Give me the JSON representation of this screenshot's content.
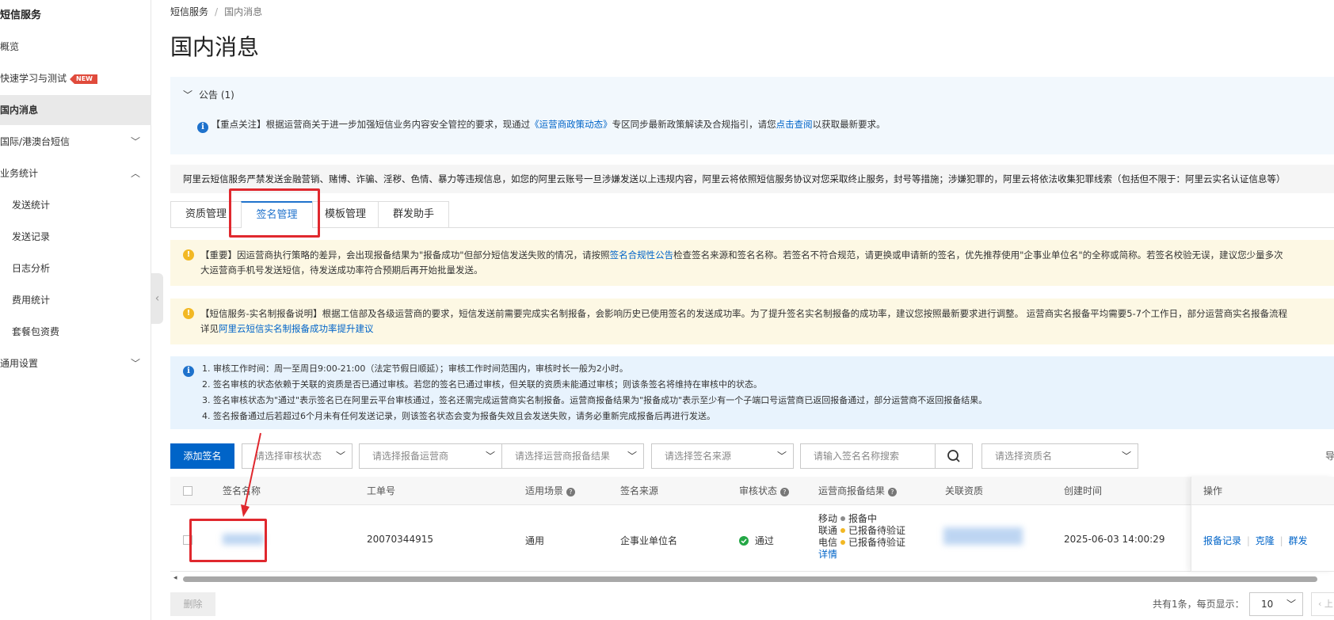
{
  "sidebar": {
    "title": "短信服务",
    "items": [
      {
        "label": "概览"
      },
      {
        "label": "快速学习与测试",
        "badge": "NEW"
      },
      {
        "label": "国内消息"
      },
      {
        "label": "国际/港澳台短信"
      },
      {
        "label": "业务统计"
      },
      {
        "label": "发送统计"
      },
      {
        "label": "发送记录"
      },
      {
        "label": "日志分析"
      },
      {
        "label": "费用统计"
      },
      {
        "label": "套餐包资费"
      },
      {
        "label": "通用设置"
      }
    ]
  },
  "breadcrumb": {
    "root": "短信服务",
    "current": "国内消息"
  },
  "page_title": "国内消息",
  "announcement": {
    "header": "公告 (1)",
    "p1": "【重点关注】根据运营商关于进一步加强短信业务内容安全管控的要求，现通过",
    "link1": "《运营商政策动态》",
    "p2": "专区同步最新政策解读及合规指引，请您",
    "link2": "点击查阅",
    "p3": "以获取最新要求。"
  },
  "warning_strip": "阿里云短信服务严禁发送金融营销、赌博、诈骗、淫秽、色情、暴力等违规信息，如您的阿里云账号一旦涉嫌发送以上违规内容，阿里云将依照短信服务协议对您采取终止服务，封号等措施；涉嫌犯罪的，阿里云将依法收集犯罪线索（包括但不限于：阿里云实名认证信息等）",
  "tabs": [
    "资质管理",
    "签名管理",
    "模板管理",
    "群发助手"
  ],
  "notice_important": {
    "a": "【重要】因运营商执行策略的差异，会出现报备结果为\"报备成功\"但部分短信发送失败的情况，请按照",
    "link": "签名合规性公告",
    "b": "检查签名来源和签名名称。若签名不符合规范，请更换或申请新的签名，优先推荐使用\"企事业单位名\"的全称或简称。若签名校验无误，建议您少量多次",
    "c": "大运营商手机号发送短信，待发送成功率符合预期后再开始批量发送。"
  },
  "notice_realname": {
    "a": "【短信服务-实名制报备说明】根据工信部及各级运营商的要求，短信发送前需要完成实名制报备，会影响历史已使用签名的发送成功率。为了提升签名实名制报备的成功率，建议您按照最新要求进行调整。 运营商实名报备平均需要5-7个工作日，部分运营商实名报备流程",
    "b": "详见",
    "link": "阿里云短信实名制报备成功率提升建议"
  },
  "info_list": [
    "1. 审核工作时间：周一至周日9:00-21:00（法定节假日顺延）；审核工作时间范围内，审核时长一般为2小时。",
    "2. 签名审核的状态依赖于关联的资质是否已通过审核。若您的签名已通过审核，但关联的资质未能通过审核；则该条签名将维持在审核中的状态。",
    "3. 签名审核状态为\"通过\"表示签名已在阿里云平台审核通过，签名还需完成运营商实名制报备。运营商报备结果为\"报备成功\"表示至少有一个子端口号运营商已返回报备通过，部分运营商不返回报备结果。",
    "4. 签名报备通过后若超过6个月未有任何发送记录，则该签名状态会变为报备失效且会发送失败，请务必重新完成报备后再进行发送。"
  ],
  "toolbar": {
    "add_button": "添加签名",
    "filter_review": "请选择审核状态",
    "filter_carrier": "请选择报备运营商",
    "filter_carrier_result": "请选择运营商报备结果",
    "filter_source": "请选择签名来源",
    "search_placeholder": "请输入签名名称搜索",
    "filter_qualification": "请选择资质名",
    "export_label": "导"
  },
  "table": {
    "columns": [
      "签名名称",
      "工单号",
      "适用场景",
      "签名来源",
      "审核状态",
      "运营商报备结果",
      "关联资质",
      "创建时间",
      "操作"
    ],
    "rows": [
      {
        "ticket": "20070344915",
        "scene": "通用",
        "source": "企事业单位名",
        "status": "通过",
        "carriers": [
          {
            "name": "移动",
            "result": "报备中",
            "color": "#8c8c8c"
          },
          {
            "name": "联通",
            "result": "已报备待验证",
            "color": "#f2b824"
          },
          {
            "name": "电信",
            "result": "已报备待验证",
            "color": "#f2b824"
          }
        ],
        "details_link": "详情",
        "created": "2025-06-03 14:00:29",
        "actions": [
          "报备记录",
          "克隆",
          "群发"
        ]
      }
    ]
  },
  "footer": {
    "delete_button": "删除",
    "total_text": "共有1条，每页显示：",
    "page_size": "10",
    "prev_label": "上"
  },
  "colors": {
    "primary": "#0064c8",
    "highlight": "#e0282e",
    "success": "#23a745"
  }
}
